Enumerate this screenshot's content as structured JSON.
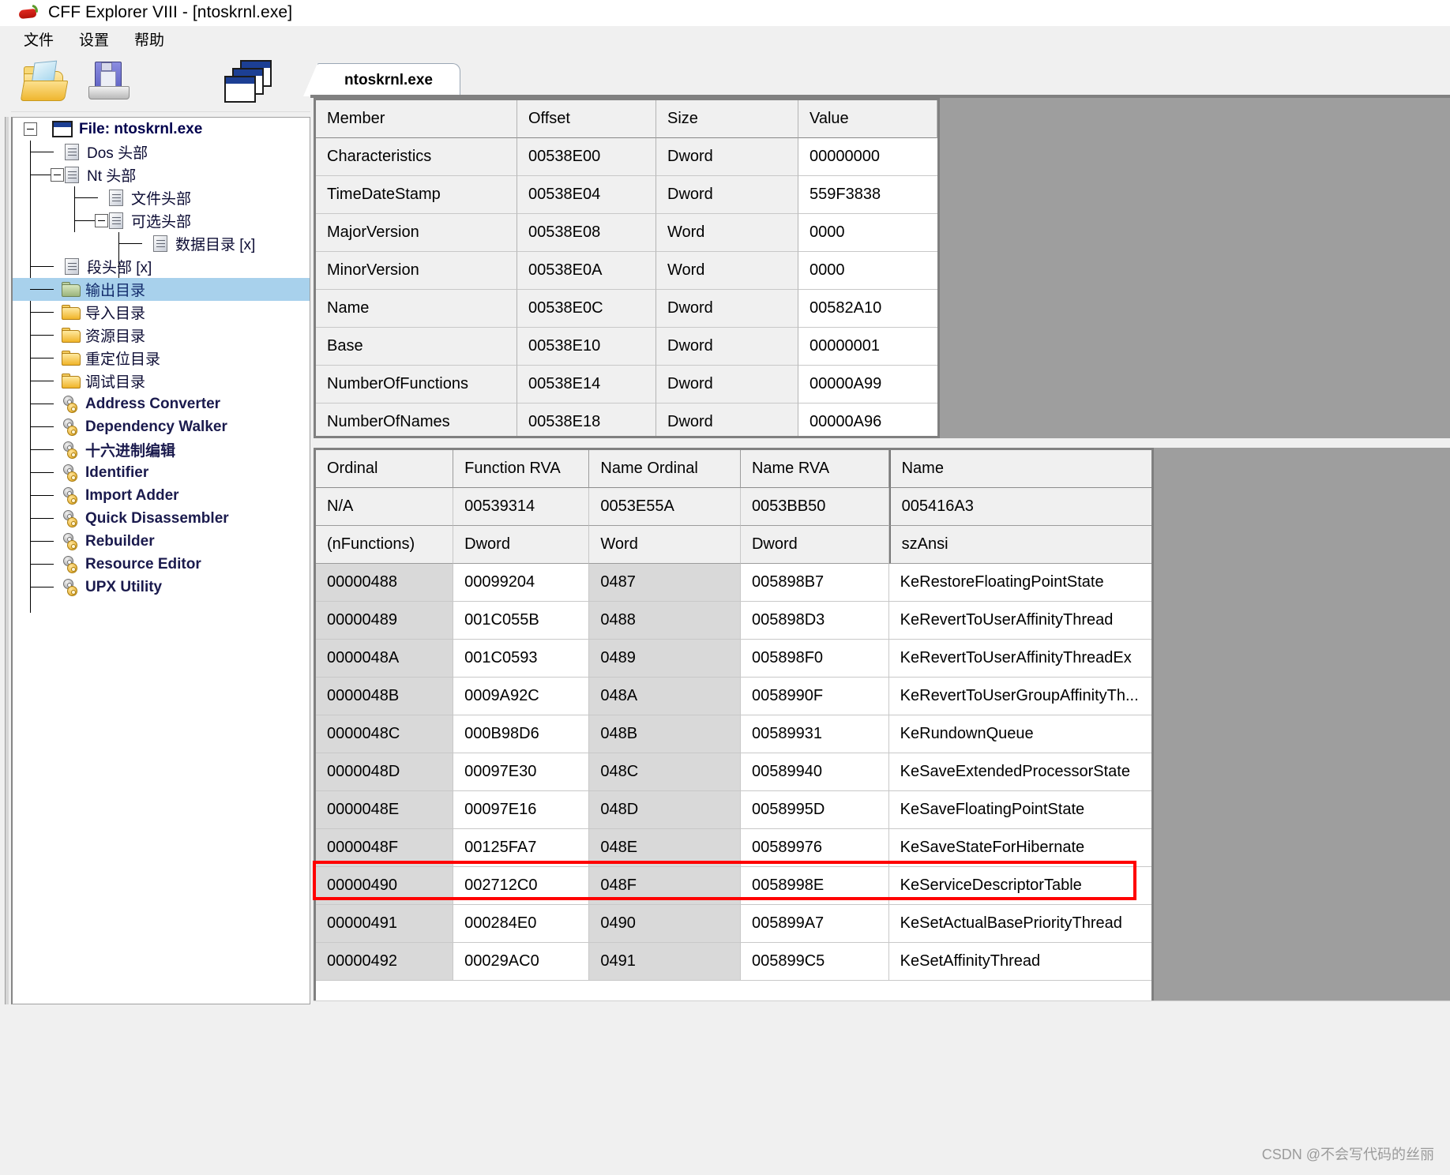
{
  "window": {
    "title": "CFF Explorer VIII - [ntoskrnl.exe]",
    "icon": "chili-pepper-icon"
  },
  "menu": [
    {
      "label": "文件"
    },
    {
      "label": "设置"
    },
    {
      "label": "帮助"
    }
  ],
  "toolbar": [
    {
      "name": "open-file-button",
      "icon": "open-folder-icon"
    },
    {
      "name": "save-file-button",
      "icon": "floppy-disk-icon"
    },
    {
      "name": "cascade-windows-button",
      "icon": "cascade-windows-icon"
    }
  ],
  "tree": {
    "root": {
      "label": "File: ntoskrnl.exe",
      "icon": "window-icon"
    },
    "items": [
      {
        "label": "Dos 头部",
        "icon": "page-icon",
        "indent": 1,
        "selected": false
      },
      {
        "label": "Nt 头部",
        "icon": "page-icon",
        "indent": 1,
        "selected": false
      },
      {
        "label": "文件头部",
        "icon": "page-icon",
        "indent": 2,
        "selected": false
      },
      {
        "label": "可选头部",
        "icon": "page-icon",
        "indent": 2,
        "selected": false
      },
      {
        "label": "数据目录 [x]",
        "icon": "page-icon",
        "indent": 3,
        "selected": false
      },
      {
        "label": "段头部 [x]",
        "icon": "page-icon",
        "indent": 1,
        "selected": false
      },
      {
        "label": "输出目录",
        "icon": "folder-green-icon",
        "indent": 1,
        "selected": true
      },
      {
        "label": "导入目录",
        "icon": "folder-icon",
        "indent": 1,
        "selected": false
      },
      {
        "label": "资源目录",
        "icon": "folder-icon",
        "indent": 1,
        "selected": false
      },
      {
        "label": "重定位目录",
        "icon": "folder-icon",
        "indent": 1,
        "selected": false
      },
      {
        "label": "调试目录",
        "icon": "folder-icon",
        "indent": 1,
        "selected": false
      },
      {
        "label": "Address Converter",
        "icon": "gears-icon",
        "indent": 1,
        "selected": false
      },
      {
        "label": "Dependency Walker",
        "icon": "gears-icon",
        "indent": 1,
        "selected": false
      },
      {
        "label": "十六进制编辑",
        "icon": "gears-icon",
        "indent": 1,
        "selected": false
      },
      {
        "label": "Identifier",
        "icon": "gears-icon",
        "indent": 1,
        "selected": false
      },
      {
        "label": "Import Adder",
        "icon": "gears-icon",
        "indent": 1,
        "selected": false
      },
      {
        "label": "Quick Disassembler",
        "icon": "gears-icon",
        "indent": 1,
        "selected": false
      },
      {
        "label": "Rebuilder",
        "icon": "gears-icon",
        "indent": 1,
        "selected": false
      },
      {
        "label": "Resource Editor",
        "icon": "gears-icon",
        "indent": 1,
        "selected": false
      },
      {
        "label": "UPX Utility",
        "icon": "gears-icon",
        "indent": 1,
        "selected": false
      }
    ]
  },
  "tab": {
    "label": "ntoskrnl.exe"
  },
  "top_grid": {
    "columns": [
      "Member",
      "Offset",
      "Size",
      "Value"
    ],
    "rows": [
      [
        "Characteristics",
        "00538E00",
        "Dword",
        "00000000"
      ],
      [
        "TimeDateStamp",
        "00538E04",
        "Dword",
        "559F3838"
      ],
      [
        "MajorVersion",
        "00538E08",
        "Word",
        "0000"
      ],
      [
        "MinorVersion",
        "00538E0A",
        "Word",
        "0000"
      ],
      [
        "Name",
        "00538E0C",
        "Dword",
        "00582A10"
      ],
      [
        "Base",
        "00538E10",
        "Dword",
        "00000001"
      ],
      [
        "NumberOfFunctions",
        "00538E14",
        "Dword",
        "00000A99"
      ],
      [
        "NumberOfNames",
        "00538E18",
        "Dword",
        "00000A96"
      ]
    ]
  },
  "bottom_grid": {
    "columns": [
      "Ordinal",
      "Function RVA",
      "Name Ordinal",
      "Name RVA",
      "Name"
    ],
    "meta_rows": [
      [
        "N/A",
        "00539314",
        "0053E55A",
        "0053BB50",
        "005416A3"
      ],
      [
        "(nFunctions)",
        "Dword",
        "Word",
        "Dword",
        "szAnsi"
      ]
    ],
    "rows": [
      {
        "ordinal": "00000488",
        "function_rva": "00099204",
        "name_ordinal": "0487",
        "name_rva": "005898B7",
        "name": "KeRestoreFloatingPointState",
        "highlighted": false
      },
      {
        "ordinal": "00000489",
        "function_rva": "001C055B",
        "name_ordinal": "0488",
        "name_rva": "005898D3",
        "name": "KeRevertToUserAffinityThread",
        "highlighted": false
      },
      {
        "ordinal": "0000048A",
        "function_rva": "001C0593",
        "name_ordinal": "0489",
        "name_rva": "005898F0",
        "name": "KeRevertToUserAffinityThreadEx",
        "highlighted": false
      },
      {
        "ordinal": "0000048B",
        "function_rva": "0009A92C",
        "name_ordinal": "048A",
        "name_rva": "0058990F",
        "name": "KeRevertToUserGroupAffinityTh...",
        "highlighted": false
      },
      {
        "ordinal": "0000048C",
        "function_rva": "000B98D6",
        "name_ordinal": "048B",
        "name_rva": "00589931",
        "name": "KeRundownQueue",
        "highlighted": false
      },
      {
        "ordinal": "0000048D",
        "function_rva": "00097E30",
        "name_ordinal": "048C",
        "name_rva": "00589940",
        "name": "KeSaveExtendedProcessorState",
        "highlighted": false
      },
      {
        "ordinal": "0000048E",
        "function_rva": "00097E16",
        "name_ordinal": "048D",
        "name_rva": "0058995D",
        "name": "KeSaveFloatingPointState",
        "highlighted": false
      },
      {
        "ordinal": "0000048F",
        "function_rva": "00125FA7",
        "name_ordinal": "048E",
        "name_rva": "00589976",
        "name": "KeSaveStateForHibernate",
        "highlighted": false
      },
      {
        "ordinal": "00000490",
        "function_rva": "002712C0",
        "name_ordinal": "048F",
        "name_rva": "0058998E",
        "name": "KeServiceDescriptorTable",
        "highlighted": true
      },
      {
        "ordinal": "00000491",
        "function_rva": "000284E0",
        "name_ordinal": "0490",
        "name_rva": "005899A7",
        "name": "KeSetActualBasePriorityThread",
        "highlighted": false
      },
      {
        "ordinal": "00000492",
        "function_rva": "00029AC0",
        "name_ordinal": "0491",
        "name_rva": "005899C5",
        "name": "KeSetAffinityThread",
        "highlighted": false
      }
    ]
  },
  "watermark": {
    "text": "CSDN @不会写代码的丝丽"
  },
  "colors": {
    "selection": "#a8d1ec",
    "highlight_box": "#ff0000",
    "grid_border": "#808080",
    "panel_bg": "#f0f0f0",
    "gray_fill": "#9e9e9e"
  }
}
